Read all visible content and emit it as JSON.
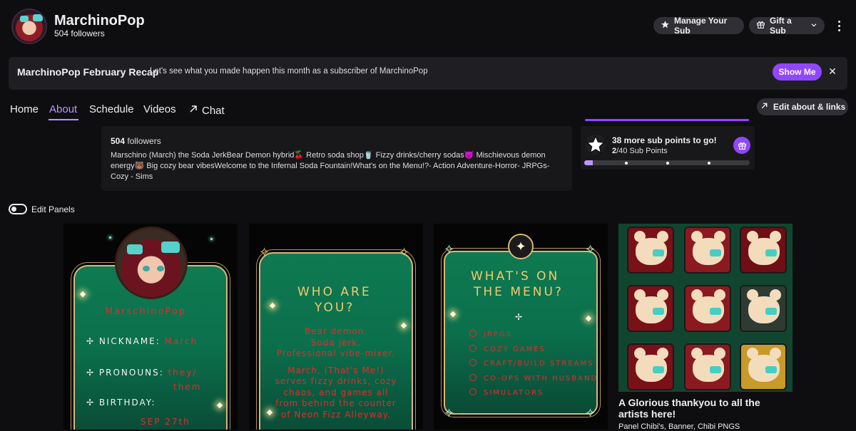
{
  "channel": {
    "name": "MarchinoPop",
    "followers_label": "504 followers"
  },
  "header_actions": {
    "manage_sub": "Manage Your Sub",
    "gift_sub": "Gift a Sub"
  },
  "recap": {
    "title": "MarchinoPop February Recap",
    "text": "Let's see what you made happen this month as a subscriber of MarchinoPop",
    "button": "Show Me"
  },
  "tabs": [
    {
      "label": "Home"
    },
    {
      "label": "About"
    },
    {
      "label": "Schedule"
    },
    {
      "label": "Videos"
    },
    {
      "label": "Chat"
    }
  ],
  "active_tab": "About",
  "edit_about_label": "Edit about & links",
  "about": {
    "followers_count": "504",
    "followers_word": "followers",
    "description": "Marschino (March) the Soda JerkBear Demon hybrid🍒 Retro soda shop🥤 Fizzy drinks/cherry sodas😈 Mischievous demon energy🐻 Big cozy bear vibesWelcome to the Infernal Soda Fountain!What's on the Menu!?- Action Adventure-Horror- JRPGs- Cozy - Sims"
  },
  "sub_points": {
    "more_label": "38 more sub points to go!",
    "current": "2",
    "total_label": "/40 Sub Points",
    "progress_fraction": 0.05
  },
  "edit_panels_label": "Edit Panels",
  "panels": {
    "p1": {
      "name": "MarschinoPop",
      "nickname_label": "NICKNAME:",
      "nickname_value": "March",
      "pronouns_label": "PRONOUNS:",
      "pronouns_value_1": "they/",
      "pronouns_value_2": "them",
      "birthday_label": "BIRTHDAY:",
      "birthday_value": "SEP 27th"
    },
    "p2": {
      "title_1": "WHO ARE",
      "title_2": "YOU?",
      "lines": [
        "Bear demon.",
        "Soda jerk.",
        "Professional vibe-mixer.",
        "",
        "March, (That's Me!)",
        "serves fizzy drinks, cozy",
        "chaos, and games all",
        "from behind the counter",
        "of Neon Fizz Alleyway."
      ]
    },
    "p3": {
      "title_1": "WHAT'S ON",
      "title_2": "THE MENU?",
      "items": [
        "JRPGS",
        "COZY GAMES",
        "CRAFT/BUILD STREAMS",
        "CO-OPS WITH HUSBAND",
        "SIMULATORS"
      ]
    },
    "p4": {
      "title": "A Glorious thankyou to all the artists here!",
      "subtitle": "Panel Chibi's, Banner, Chibi PNGS"
    }
  },
  "colors": {
    "accent": "#9147ff",
    "accent_light": "#bf94ff",
    "panel_green": "#0e7a52",
    "panel_gold": "#f4c96a",
    "panel_red": "#e52b2b"
  },
  "icons": [
    "star-icon",
    "gift-icon",
    "chevron-down-icon",
    "more-icon",
    "close-icon",
    "external-link-icon"
  ]
}
